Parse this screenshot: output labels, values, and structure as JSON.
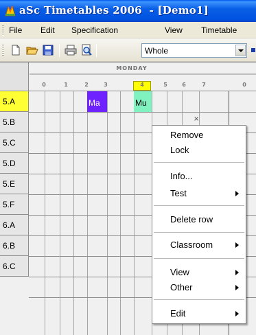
{
  "window": {
    "title": "aSc Timetables 2006  - [Demo1]",
    "icon": "asc-timetables-app-icon"
  },
  "menubar": {
    "items": [
      "File",
      "Edit",
      "Specification",
      "View",
      "Timetable"
    ]
  },
  "toolbar": {
    "icons": [
      "new-icon",
      "open-icon",
      "save-icon",
      "print-icon",
      "print-preview-icon"
    ],
    "view_select": "Whole"
  },
  "timetable": {
    "day": "MONDAY",
    "periods": [
      "0",
      "1",
      "2",
      "3",
      "4",
      "5",
      "6",
      "7",
      "0"
    ],
    "current_period": "4",
    "rows": [
      "5.A",
      "5.B",
      "5.C",
      "5.D",
      "5.E",
      "5.F",
      "6.A",
      "6.B",
      "6.C"
    ],
    "selected_row": "5.A",
    "lessons": [
      {
        "class": "5.A",
        "period": "2",
        "subject": "Ma",
        "color": "#6e22ff"
      },
      {
        "class": "5.A",
        "period": "4",
        "subject": "Mu",
        "color": "#7ff2c0"
      }
    ],
    "marker": "×"
  },
  "context_menu": {
    "groups": [
      [
        {
          "label": "Remove",
          "submenu": false
        },
        {
          "label": "Lock",
          "submenu": false
        }
      ],
      [
        {
          "label": "Info...",
          "submenu": false
        },
        {
          "label": "Test",
          "submenu": true
        }
      ],
      [
        {
          "label": "Delete row",
          "submenu": false
        }
      ],
      [
        {
          "label": "Classroom",
          "submenu": true
        }
      ],
      [
        {
          "label": "View",
          "submenu": true
        },
        {
          "label": "Other",
          "submenu": true
        }
      ],
      [
        {
          "label": "Edit",
          "submenu": true
        }
      ]
    ]
  },
  "colors": {
    "titlebar": "#0a5fe6",
    "selected_row": "#ffff33",
    "current_period": "#ffff00"
  }
}
